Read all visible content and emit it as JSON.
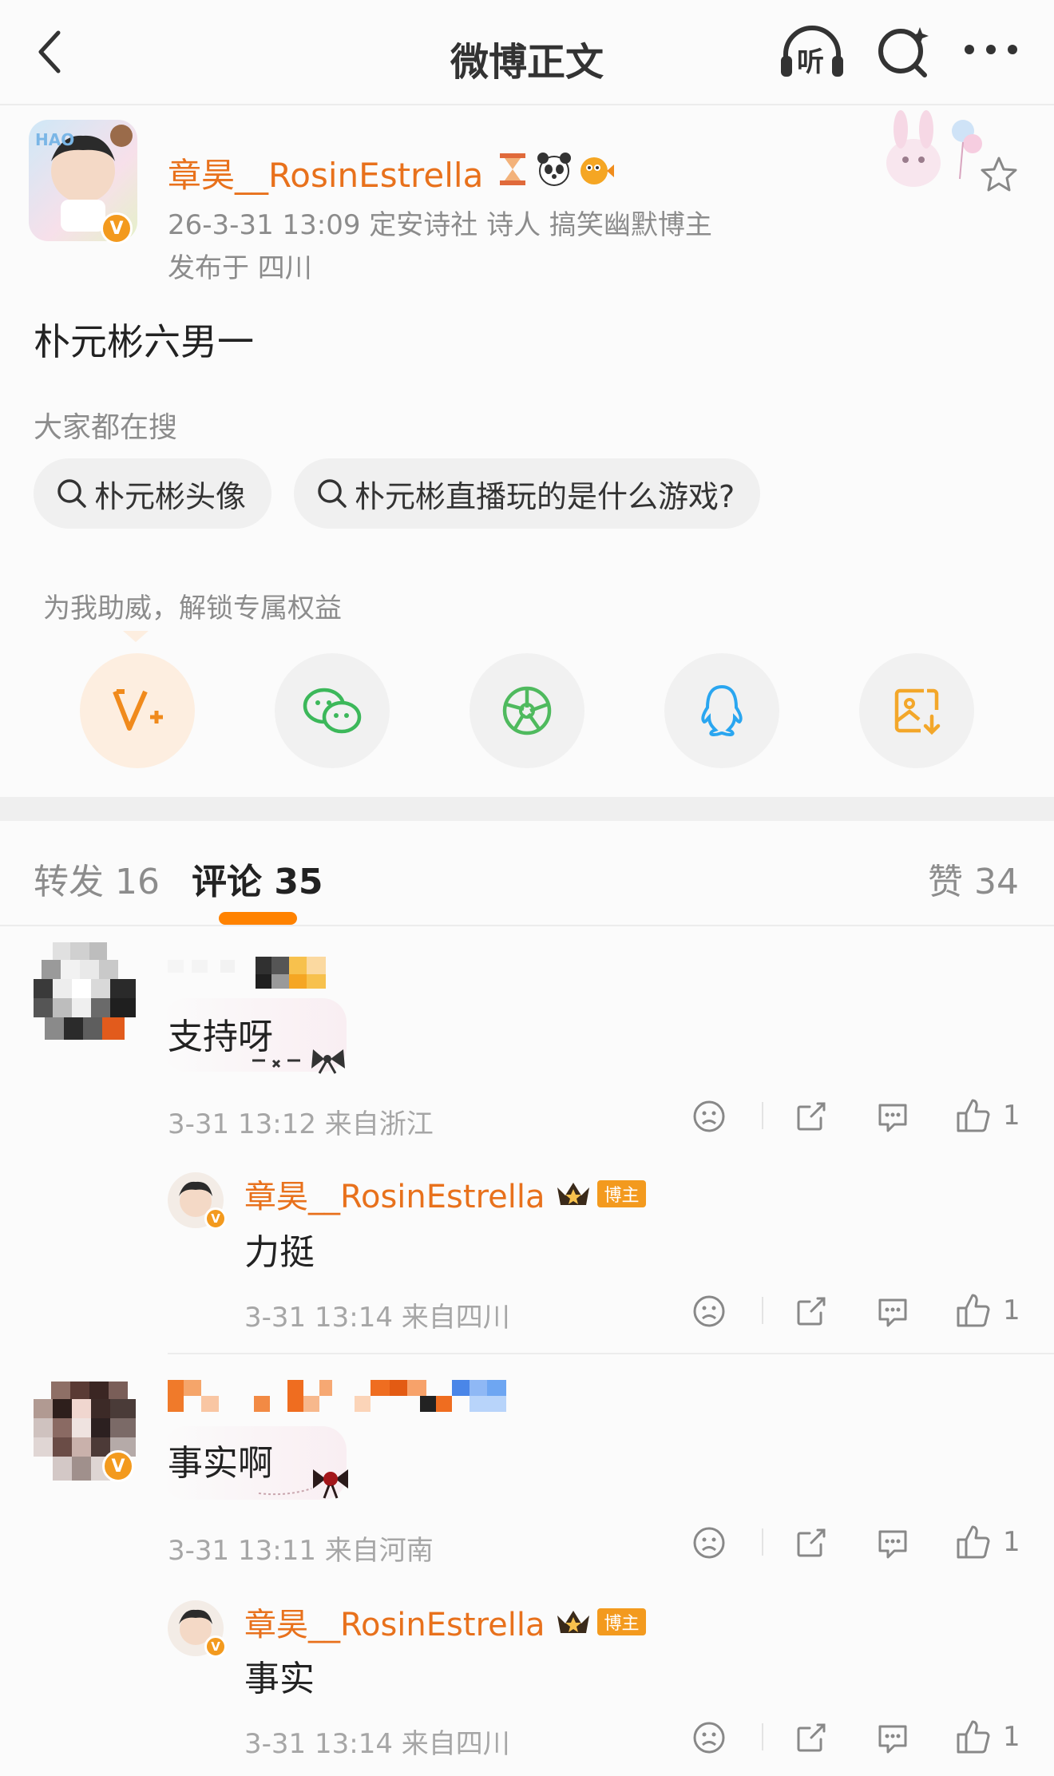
{
  "nav": {
    "title": "微博正文",
    "listen_label": "听"
  },
  "post": {
    "author": "章昊__RosinEstrella",
    "meta_line": "26-3-31 13:09  定安诗社 诗人 搞笑幽默博主",
    "location_line": "发布于 四川",
    "content": "朴元彬六男一"
  },
  "search": {
    "heading": "大家都在搜",
    "chips": [
      "朴元彬头像",
      "朴元彬直播玩的是什么游戏?"
    ]
  },
  "boost": {
    "text": "为我助威，解锁专属权益",
    "share_icons": [
      "vplus-icon",
      "wechat-icon",
      "moments-icon",
      "qq-icon",
      "save-image-icon"
    ]
  },
  "tabs": {
    "repost": "转发 16",
    "comment": "评论 35",
    "like": "赞 34"
  },
  "comments": [
    {
      "text": "支持呀",
      "time": "3-31 13:12  来自浙江",
      "likes": "1",
      "reply": {
        "author": "章昊__RosinEstrella",
        "badge": "博主",
        "text": "力挺",
        "time": "3-31 13:14  来自四川",
        "likes": "1"
      }
    },
    {
      "text": "事实啊",
      "time": "3-31 13:11  来自河南",
      "likes": "1",
      "reply": {
        "author": "章昊__RosinEstrella",
        "badge": "博主",
        "text": "事实",
        "time": "3-31 13:14  来自四川",
        "likes": "1"
      }
    }
  ],
  "colors": {
    "accent": "#e8711c",
    "tab_underline": "#ff8200",
    "verified": "#f39a1e"
  }
}
